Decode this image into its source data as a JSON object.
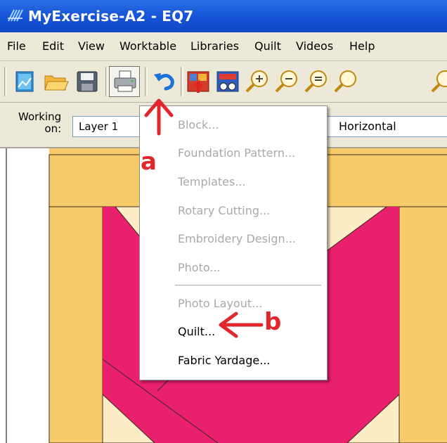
{
  "window": {
    "title": "MyExercise-A2 - EQ7"
  },
  "menubar": {
    "items": [
      "File",
      "Edit",
      "View",
      "Worktable",
      "Libraries",
      "Quilt",
      "Videos",
      "Help"
    ]
  },
  "toolbar": {
    "buttons": [
      "new-file-icon",
      "open-folder-icon",
      "save-icon",
      "print-icon",
      "undo-icon",
      "add-to-sketchbook-icon",
      "view-sketchbook-icon",
      "zoom-in-icon",
      "zoom-out-icon",
      "fit-to-worktable-icon",
      "refresh-icon"
    ]
  },
  "workbar": {
    "working_label_line1": "Working",
    "working_label_line2": "on:",
    "layer_value": "Layer 1",
    "orientation_value": "Horizontal"
  },
  "print_menu": {
    "items": [
      {
        "label": "Block...",
        "enabled": false
      },
      {
        "label": "Foundation Pattern...",
        "enabled": false
      },
      {
        "label": "Templates...",
        "enabled": false
      },
      {
        "label": "Rotary Cutting...",
        "enabled": false
      },
      {
        "label": "Embroidery Design...",
        "enabled": false
      },
      {
        "label": "Photo...",
        "enabled": false
      },
      {
        "label": "Photo Layout...",
        "enabled": false
      },
      {
        "label": "Quilt...",
        "enabled": true
      },
      {
        "label": "Fabric Yardage...",
        "enabled": true
      }
    ]
  },
  "annotations": {
    "a": "a",
    "b": "b"
  },
  "colors": {
    "accent_red": "#e1262c",
    "quilt_gold": "#f7ca6a",
    "quilt_pink": "#e8206e",
    "quilt_cream": "#fcedc7",
    "titlebar_blue": "#1553d6"
  }
}
